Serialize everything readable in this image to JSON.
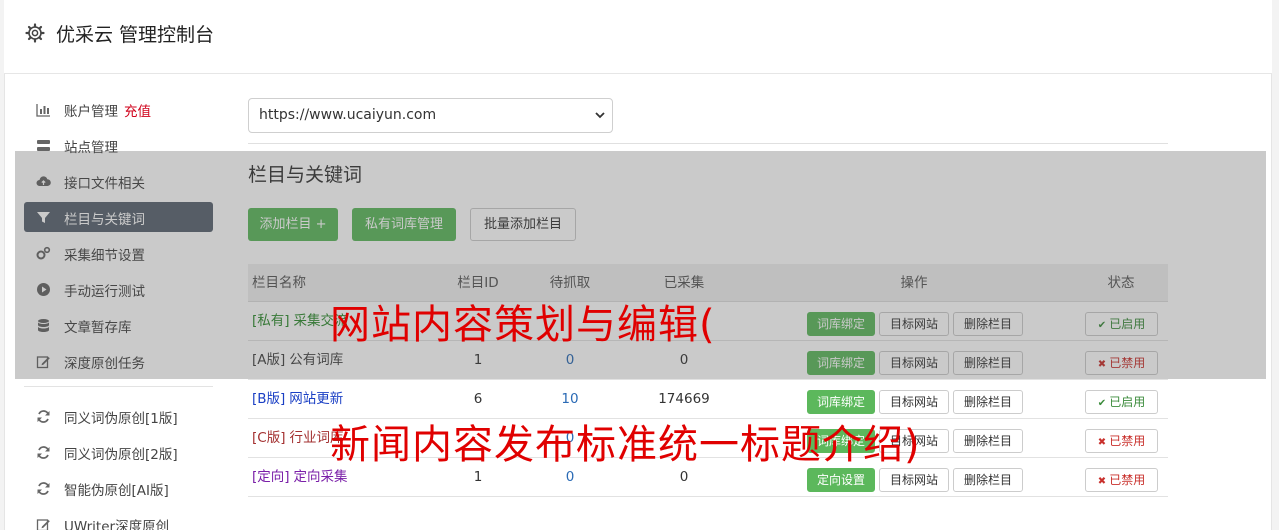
{
  "header": {
    "title": "优采云 管理控制台"
  },
  "sidebar": {
    "items": [
      {
        "label": "账户管理",
        "extra": "充值",
        "icon": "bar-chart-icon"
      },
      {
        "label": "站点管理",
        "icon": "server-icon"
      },
      {
        "label": "接口文件相关",
        "icon": "cloud-upload-icon"
      },
      {
        "label": "栏目与关键词",
        "icon": "filter-icon",
        "active": true
      },
      {
        "label": "采集细节设置",
        "icon": "cogs-icon"
      },
      {
        "label": "手动运行测试",
        "icon": "play-circle-icon"
      },
      {
        "label": "文章暂存库",
        "icon": "database-icon"
      },
      {
        "label": "深度原创任务",
        "icon": "edit-icon"
      }
    ],
    "items2": [
      {
        "label": "同义词伪原创[1版]",
        "icon": "refresh-icon"
      },
      {
        "label": "同义词伪原创[2版]",
        "icon": "refresh-icon"
      },
      {
        "label": "智能伪原创[AI版]",
        "icon": "refresh-icon"
      },
      {
        "label": "UWriter深度原创",
        "icon": "edit-icon"
      }
    ]
  },
  "main": {
    "site_select": "https://www.ucaiyun.com",
    "section_title": "栏目与关键词",
    "buttons": {
      "add": "添加栏目 +",
      "private_lib": "私有词库管理",
      "batch_add": "批量添加栏目"
    }
  },
  "table": {
    "headers": {
      "name": "栏目名称",
      "id": "栏目ID",
      "pending": "待抓取",
      "done": "已采集",
      "ops": "操作",
      "state": "状态"
    },
    "rows": [
      {
        "tag": "[私有]",
        "name": "采集交流",
        "id": "",
        "pending": "",
        "done": "",
        "ops": [
          "词库绑定",
          "目标网站",
          "删除栏目"
        ],
        "state": "已启用",
        "color": "#2e8b2e"
      },
      {
        "tag": "[A版]",
        "name": "公有词库",
        "id": "1",
        "pending": "0",
        "done": "0",
        "ops": [
          "词库绑定",
          "目标网站",
          "删除栏目"
        ],
        "state": "已禁用",
        "color": "#444444"
      },
      {
        "tag": "[B版]",
        "name": "网站更新",
        "id": "6",
        "pending": "10",
        "done": "174669",
        "ops": [
          "词库绑定",
          "目标网站",
          "删除栏目"
        ],
        "state": "已启用",
        "color": "#1a3fc4"
      },
      {
        "tag": "[C版]",
        "name": "行业词库",
        "id": "",
        "pending": "0",
        "done": "",
        "ops": [
          "词库绑定",
          "目标网站",
          "删除栏目"
        ],
        "state": "已禁用",
        "color": "#a33030"
      },
      {
        "tag": "[定向]",
        "name": "定向采集",
        "id": "1",
        "pending": "0",
        "done": "0",
        "ops": [
          "定向设置",
          "目标网站",
          "删除栏目"
        ],
        "state": "已禁用",
        "color": "#7a1fa8"
      }
    ]
  },
  "watermark": {
    "line1": "网站内容策划与编辑(",
    "line2": "新闻内容发布标准统一标题介绍)"
  }
}
